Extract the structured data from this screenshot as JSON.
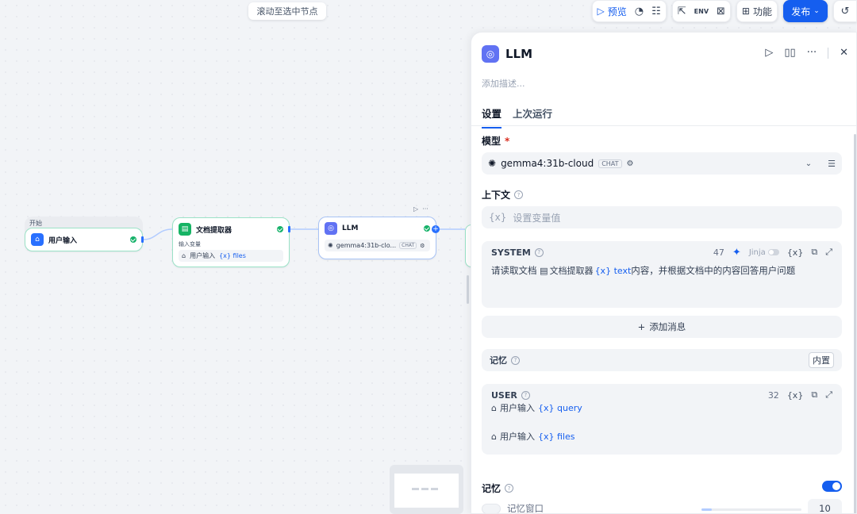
{
  "canvas": {
    "scroll_tip": "滚动至选中节点",
    "start_node": {
      "group_label": "开始",
      "title": "用户输入"
    },
    "extractor_node": {
      "title": "文档提取器",
      "sub_label": "输入变量",
      "var_source": "用户输入",
      "var_name": "{x} files"
    },
    "llm_node": {
      "title": "LLM",
      "model": "gemma4:31b-clo...",
      "tag": "CHAT"
    }
  },
  "toolbar": {
    "preview": "预览",
    "features": "功能",
    "publish": "发布"
  },
  "panel": {
    "title": "LLM",
    "description_placeholder": "添加描述...",
    "tabs": [
      {
        "label": "设置",
        "active": true
      },
      {
        "label": "上次运行",
        "active": false
      }
    ],
    "model": {
      "label": "模型",
      "required_mark": "*",
      "name": "gemma4:31b-cloud",
      "tag": "CHAT"
    },
    "context": {
      "label": "上下文",
      "placeholder": "设置变量值"
    },
    "system_prompt": {
      "role": "SYSTEM",
      "count": "47",
      "jinja": "Jinja",
      "text_before": "请读取文档",
      "var_source": "文档提取器",
      "var_name": "{x} text",
      "text_after": "内容，并根据文档中的内容回答用户问题"
    },
    "add_message": "添加消息",
    "memory_row": {
      "label": "记忆",
      "badge": "内置"
    },
    "user_prompt": {
      "role": "USER",
      "count": "32",
      "line1_source": "用户输入",
      "line1_var": "{x} query",
      "line2_source": "用户输入",
      "line2_var": "{x} files"
    },
    "memory": {
      "label": "记忆",
      "enabled": true,
      "window_label": "记忆窗口",
      "window_value": "10",
      "window_slider_fraction": 0.1
    }
  },
  "colors": {
    "accent": "#155eef",
    "success": "#17b26a",
    "llm_icon": "#6172f3",
    "extractor_icon": "#16b364",
    "start_icon": "#2970ff"
  }
}
